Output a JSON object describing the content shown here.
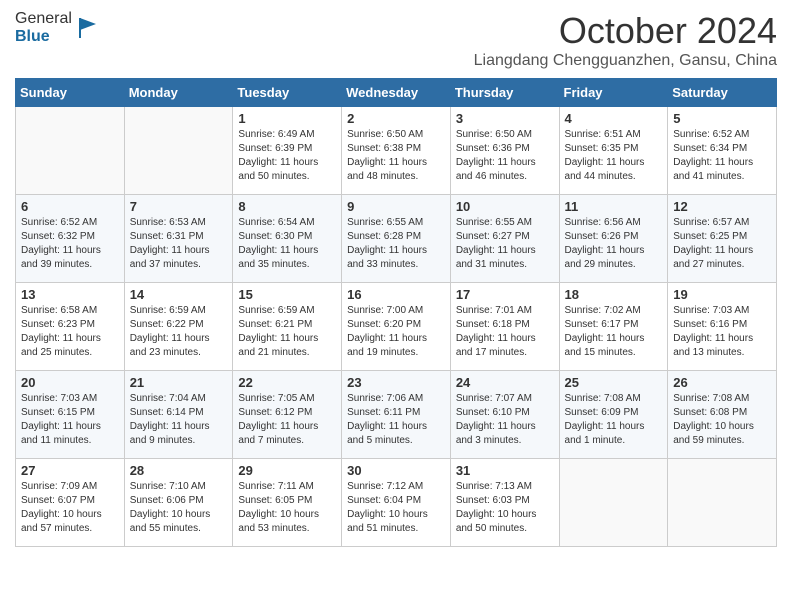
{
  "logo": {
    "general": "General",
    "blue": "Blue"
  },
  "header": {
    "month": "October 2024",
    "location": "Liangdang Chengguanzhen, Gansu, China"
  },
  "weekdays": [
    "Sunday",
    "Monday",
    "Tuesday",
    "Wednesday",
    "Thursday",
    "Friday",
    "Saturday"
  ],
  "weeks": [
    [
      {
        "day": "",
        "info": ""
      },
      {
        "day": "",
        "info": ""
      },
      {
        "day": "1",
        "info": "Sunrise: 6:49 AM\nSunset: 6:39 PM\nDaylight: 11 hours and 50 minutes."
      },
      {
        "day": "2",
        "info": "Sunrise: 6:50 AM\nSunset: 6:38 PM\nDaylight: 11 hours and 48 minutes."
      },
      {
        "day": "3",
        "info": "Sunrise: 6:50 AM\nSunset: 6:36 PM\nDaylight: 11 hours and 46 minutes."
      },
      {
        "day": "4",
        "info": "Sunrise: 6:51 AM\nSunset: 6:35 PM\nDaylight: 11 hours and 44 minutes."
      },
      {
        "day": "5",
        "info": "Sunrise: 6:52 AM\nSunset: 6:34 PM\nDaylight: 11 hours and 41 minutes."
      }
    ],
    [
      {
        "day": "6",
        "info": "Sunrise: 6:52 AM\nSunset: 6:32 PM\nDaylight: 11 hours and 39 minutes."
      },
      {
        "day": "7",
        "info": "Sunrise: 6:53 AM\nSunset: 6:31 PM\nDaylight: 11 hours and 37 minutes."
      },
      {
        "day": "8",
        "info": "Sunrise: 6:54 AM\nSunset: 6:30 PM\nDaylight: 11 hours and 35 minutes."
      },
      {
        "day": "9",
        "info": "Sunrise: 6:55 AM\nSunset: 6:28 PM\nDaylight: 11 hours and 33 minutes."
      },
      {
        "day": "10",
        "info": "Sunrise: 6:55 AM\nSunset: 6:27 PM\nDaylight: 11 hours and 31 minutes."
      },
      {
        "day": "11",
        "info": "Sunrise: 6:56 AM\nSunset: 6:26 PM\nDaylight: 11 hours and 29 minutes."
      },
      {
        "day": "12",
        "info": "Sunrise: 6:57 AM\nSunset: 6:25 PM\nDaylight: 11 hours and 27 minutes."
      }
    ],
    [
      {
        "day": "13",
        "info": "Sunrise: 6:58 AM\nSunset: 6:23 PM\nDaylight: 11 hours and 25 minutes."
      },
      {
        "day": "14",
        "info": "Sunrise: 6:59 AM\nSunset: 6:22 PM\nDaylight: 11 hours and 23 minutes."
      },
      {
        "day": "15",
        "info": "Sunrise: 6:59 AM\nSunset: 6:21 PM\nDaylight: 11 hours and 21 minutes."
      },
      {
        "day": "16",
        "info": "Sunrise: 7:00 AM\nSunset: 6:20 PM\nDaylight: 11 hours and 19 minutes."
      },
      {
        "day": "17",
        "info": "Sunrise: 7:01 AM\nSunset: 6:18 PM\nDaylight: 11 hours and 17 minutes."
      },
      {
        "day": "18",
        "info": "Sunrise: 7:02 AM\nSunset: 6:17 PM\nDaylight: 11 hours and 15 minutes."
      },
      {
        "day": "19",
        "info": "Sunrise: 7:03 AM\nSunset: 6:16 PM\nDaylight: 11 hours and 13 minutes."
      }
    ],
    [
      {
        "day": "20",
        "info": "Sunrise: 7:03 AM\nSunset: 6:15 PM\nDaylight: 11 hours and 11 minutes."
      },
      {
        "day": "21",
        "info": "Sunrise: 7:04 AM\nSunset: 6:14 PM\nDaylight: 11 hours and 9 minutes."
      },
      {
        "day": "22",
        "info": "Sunrise: 7:05 AM\nSunset: 6:12 PM\nDaylight: 11 hours and 7 minutes."
      },
      {
        "day": "23",
        "info": "Sunrise: 7:06 AM\nSunset: 6:11 PM\nDaylight: 11 hours and 5 minutes."
      },
      {
        "day": "24",
        "info": "Sunrise: 7:07 AM\nSunset: 6:10 PM\nDaylight: 11 hours and 3 minutes."
      },
      {
        "day": "25",
        "info": "Sunrise: 7:08 AM\nSunset: 6:09 PM\nDaylight: 11 hours and 1 minute."
      },
      {
        "day": "26",
        "info": "Sunrise: 7:08 AM\nSunset: 6:08 PM\nDaylight: 10 hours and 59 minutes."
      }
    ],
    [
      {
        "day": "27",
        "info": "Sunrise: 7:09 AM\nSunset: 6:07 PM\nDaylight: 10 hours and 57 minutes."
      },
      {
        "day": "28",
        "info": "Sunrise: 7:10 AM\nSunset: 6:06 PM\nDaylight: 10 hours and 55 minutes."
      },
      {
        "day": "29",
        "info": "Sunrise: 7:11 AM\nSunset: 6:05 PM\nDaylight: 10 hours and 53 minutes."
      },
      {
        "day": "30",
        "info": "Sunrise: 7:12 AM\nSunset: 6:04 PM\nDaylight: 10 hours and 51 minutes."
      },
      {
        "day": "31",
        "info": "Sunrise: 7:13 AM\nSunset: 6:03 PM\nDaylight: 10 hours and 50 minutes."
      },
      {
        "day": "",
        "info": ""
      },
      {
        "day": "",
        "info": ""
      }
    ]
  ]
}
